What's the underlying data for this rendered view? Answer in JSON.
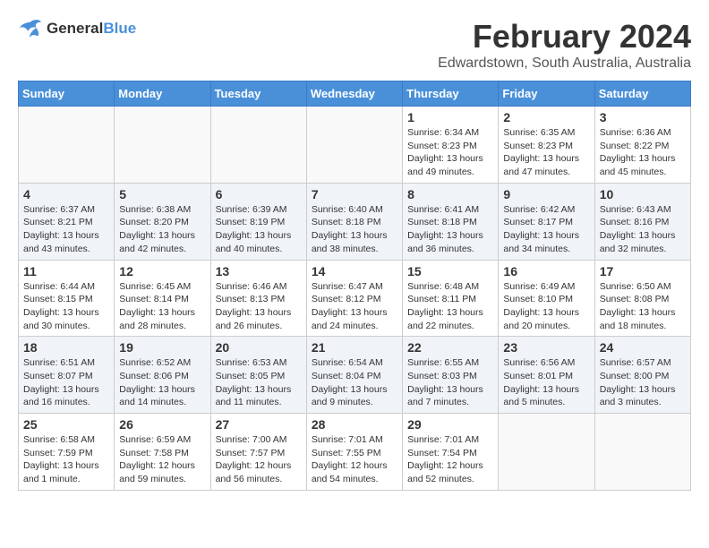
{
  "logo": {
    "line1": "General",
    "line2": "Blue"
  },
  "title": "February 2024",
  "location": "Edwardstown, South Australia, Australia",
  "headers": [
    "Sunday",
    "Monday",
    "Tuesday",
    "Wednesday",
    "Thursday",
    "Friday",
    "Saturday"
  ],
  "weeks": [
    [
      {
        "day": "",
        "info": ""
      },
      {
        "day": "",
        "info": ""
      },
      {
        "day": "",
        "info": ""
      },
      {
        "day": "",
        "info": ""
      },
      {
        "day": "1",
        "info": "Sunrise: 6:34 AM\nSunset: 8:23 PM\nDaylight: 13 hours\nand 49 minutes."
      },
      {
        "day": "2",
        "info": "Sunrise: 6:35 AM\nSunset: 8:23 PM\nDaylight: 13 hours\nand 47 minutes."
      },
      {
        "day": "3",
        "info": "Sunrise: 6:36 AM\nSunset: 8:22 PM\nDaylight: 13 hours\nand 45 minutes."
      }
    ],
    [
      {
        "day": "4",
        "info": "Sunrise: 6:37 AM\nSunset: 8:21 PM\nDaylight: 13 hours\nand 43 minutes."
      },
      {
        "day": "5",
        "info": "Sunrise: 6:38 AM\nSunset: 8:20 PM\nDaylight: 13 hours\nand 42 minutes."
      },
      {
        "day": "6",
        "info": "Sunrise: 6:39 AM\nSunset: 8:19 PM\nDaylight: 13 hours\nand 40 minutes."
      },
      {
        "day": "7",
        "info": "Sunrise: 6:40 AM\nSunset: 8:18 PM\nDaylight: 13 hours\nand 38 minutes."
      },
      {
        "day": "8",
        "info": "Sunrise: 6:41 AM\nSunset: 8:18 PM\nDaylight: 13 hours\nand 36 minutes."
      },
      {
        "day": "9",
        "info": "Sunrise: 6:42 AM\nSunset: 8:17 PM\nDaylight: 13 hours\nand 34 minutes."
      },
      {
        "day": "10",
        "info": "Sunrise: 6:43 AM\nSunset: 8:16 PM\nDaylight: 13 hours\nand 32 minutes."
      }
    ],
    [
      {
        "day": "11",
        "info": "Sunrise: 6:44 AM\nSunset: 8:15 PM\nDaylight: 13 hours\nand 30 minutes."
      },
      {
        "day": "12",
        "info": "Sunrise: 6:45 AM\nSunset: 8:14 PM\nDaylight: 13 hours\nand 28 minutes."
      },
      {
        "day": "13",
        "info": "Sunrise: 6:46 AM\nSunset: 8:13 PM\nDaylight: 13 hours\nand 26 minutes."
      },
      {
        "day": "14",
        "info": "Sunrise: 6:47 AM\nSunset: 8:12 PM\nDaylight: 13 hours\nand 24 minutes."
      },
      {
        "day": "15",
        "info": "Sunrise: 6:48 AM\nSunset: 8:11 PM\nDaylight: 13 hours\nand 22 minutes."
      },
      {
        "day": "16",
        "info": "Sunrise: 6:49 AM\nSunset: 8:10 PM\nDaylight: 13 hours\nand 20 minutes."
      },
      {
        "day": "17",
        "info": "Sunrise: 6:50 AM\nSunset: 8:08 PM\nDaylight: 13 hours\nand 18 minutes."
      }
    ],
    [
      {
        "day": "18",
        "info": "Sunrise: 6:51 AM\nSunset: 8:07 PM\nDaylight: 13 hours\nand 16 minutes."
      },
      {
        "day": "19",
        "info": "Sunrise: 6:52 AM\nSunset: 8:06 PM\nDaylight: 13 hours\nand 14 minutes."
      },
      {
        "day": "20",
        "info": "Sunrise: 6:53 AM\nSunset: 8:05 PM\nDaylight: 13 hours\nand 11 minutes."
      },
      {
        "day": "21",
        "info": "Sunrise: 6:54 AM\nSunset: 8:04 PM\nDaylight: 13 hours\nand 9 minutes."
      },
      {
        "day": "22",
        "info": "Sunrise: 6:55 AM\nSunset: 8:03 PM\nDaylight: 13 hours\nand 7 minutes."
      },
      {
        "day": "23",
        "info": "Sunrise: 6:56 AM\nSunset: 8:01 PM\nDaylight: 13 hours\nand 5 minutes."
      },
      {
        "day": "24",
        "info": "Sunrise: 6:57 AM\nSunset: 8:00 PM\nDaylight: 13 hours\nand 3 minutes."
      }
    ],
    [
      {
        "day": "25",
        "info": "Sunrise: 6:58 AM\nSunset: 7:59 PM\nDaylight: 13 hours\nand 1 minute."
      },
      {
        "day": "26",
        "info": "Sunrise: 6:59 AM\nSunset: 7:58 PM\nDaylight: 12 hours\nand 59 minutes."
      },
      {
        "day": "27",
        "info": "Sunrise: 7:00 AM\nSunset: 7:57 PM\nDaylight: 12 hours\nand 56 minutes."
      },
      {
        "day": "28",
        "info": "Sunrise: 7:01 AM\nSunset: 7:55 PM\nDaylight: 12 hours\nand 54 minutes."
      },
      {
        "day": "29",
        "info": "Sunrise: 7:01 AM\nSunset: 7:54 PM\nDaylight: 12 hours\nand 52 minutes."
      },
      {
        "day": "",
        "info": ""
      },
      {
        "day": "",
        "info": ""
      }
    ]
  ]
}
